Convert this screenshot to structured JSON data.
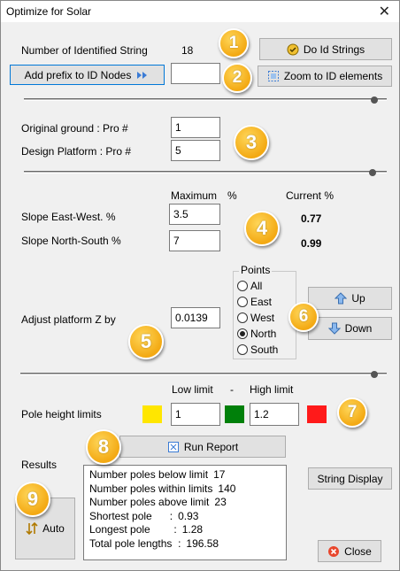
{
  "window": {
    "title": "Optimize for Solar"
  },
  "strings": {
    "identified_label": "Number of Identified  String",
    "identified_count": "18",
    "do_id_strings": "Do Id Strings",
    "add_prefix": "Add prefix to ID Nodes",
    "prefix_value": "",
    "zoom_to_id": "Zoom to ID elements"
  },
  "pro": {
    "original_ground_label": "Original ground : Pro #",
    "original_ground_value": "1",
    "design_platform_label": "Design Platform : Pro #",
    "design_platform_value": "5"
  },
  "slope": {
    "header_maximum": "Maximum",
    "header_pct": "%",
    "header_current": "Current %",
    "east_west_label": "Slope East-West. %",
    "east_west_max": "3.5",
    "east_west_current": "0.77",
    "north_south_label": "Slope North-South %",
    "north_south_max": "7",
    "north_south_current": "0.99"
  },
  "platform": {
    "adjust_label": "Adjust platform Z by",
    "adjust_value": "0.0139",
    "points_title": "Points",
    "points": [
      "All",
      "East",
      "West",
      "North",
      "South"
    ],
    "selected_point": "North",
    "up": "Up",
    "down": "Down"
  },
  "limits": {
    "low_header": "Low limit",
    "dash": "-",
    "high_header": "High limit",
    "label": "Pole height limits",
    "low_value": "1",
    "high_value": "1.2",
    "colors": {
      "below": "#ffe600",
      "within": "#00800a",
      "above": "#ff1a1a"
    }
  },
  "report": {
    "run_report": "Run Report",
    "results_label": "Results",
    "string_display": "String Display",
    "auto": "Auto",
    "close": "Close",
    "results": [
      {
        "label": "Number poles below limit",
        "value": "17"
      },
      {
        "label": "Number poles within limits",
        "value": "140"
      },
      {
        "label": "Number poles above limit",
        "value": "23"
      },
      {
        "label": "Shortest pole      :",
        "value": "0.93"
      },
      {
        "label": "Longest pole        :",
        "value": "1.28"
      },
      {
        "label": "Total pole lengths  :",
        "value": "196.58"
      }
    ]
  },
  "badges": [
    "1",
    "2",
    "3",
    "4",
    "5",
    "6",
    "7",
    "8",
    "9"
  ],
  "icons": {
    "do_id": "id-badge-icon",
    "add_prefix": "double-arrow-icon",
    "zoom": "zoom-frame-icon",
    "up": "arrow-up-icon",
    "down": "arrow-down-icon",
    "run_report": "report-icon",
    "auto": "sort-arrows-icon",
    "close": "close-circle-icon"
  }
}
